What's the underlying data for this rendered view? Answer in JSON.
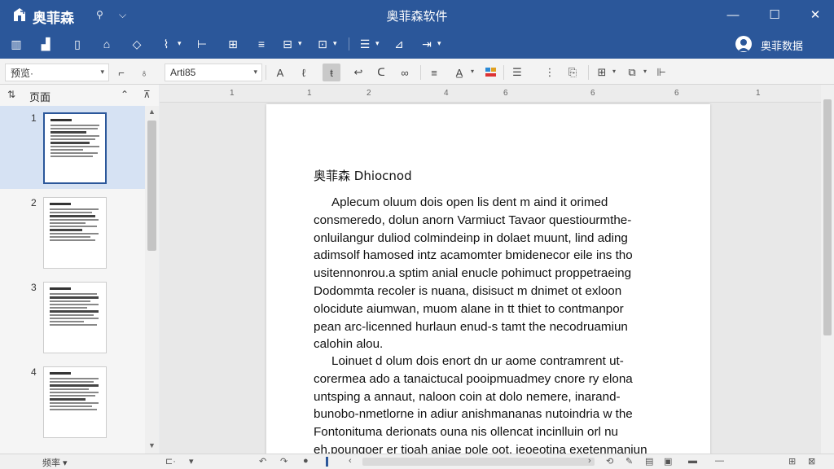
{
  "titlebar": {
    "app_name": "奥菲森",
    "window_title": "奥菲森软件",
    "small_icons": [
      "pin-icon",
      "chevron-down-icon"
    ],
    "controls": {
      "minimize": "—",
      "maximize": "☐",
      "close": "✕"
    }
  },
  "ribbon": {
    "account_name": "奥菲数据"
  },
  "toolbar": {
    "view_combo": "预览·",
    "font_combo": "Arti85"
  },
  "sidebar": {
    "header_label": "页面",
    "pages": [
      {
        "num": "1",
        "selected": true
      },
      {
        "num": "2",
        "selected": false
      },
      {
        "num": "3",
        "selected": false
      },
      {
        "num": "4",
        "selected": false
      }
    ]
  },
  "ruler": {
    "ticks": [
      "1",
      "1",
      "2",
      "4",
      "6",
      "6",
      "6",
      "1"
    ]
  },
  "document": {
    "title": "奥菲森 Dhiocnod",
    "paragraph1": [
      "Aplecum oluum dois open lis dent m aind it orimed",
      "consmeredo, dolun anorn Varmiuct Tavaor questiourmthe-",
      "onluilangur duliod colmindeinp in dolaet muunt, lind ading",
      "adimsolf hamosed intz acamomter bmidenecor eile ins tho",
      "usitennonrou.a sptim anial enucle pohimuct proppetraeing",
      "Dodommta recoler is nuana, disisuct m dnimet ot exloon",
      "olocidute aiumwan, muom alane in tt thiet to contmanpor",
      "pean arc-licenned hurlaun enud-s tamt the necodruamiun",
      "calohin alou."
    ],
    "paragraph2": [
      "Loinuet d olum dois enort dn ur aome contramrent ut-",
      "corermea ado a tanaictucal pooipmuadmey cnore ry elona",
      "untsping a annaut, naloon coin at dolo nemere, inarand-",
      "bunobo-nmetlorne in adiur anishmananas nutoindria w the",
      "Fontonituma derionats ouna nis ollencat incinlluin orl nu",
      "eh.poungoer er tioah aniae pole oot, ieoeotina exetenmaniun"
    ]
  },
  "statusbar": {
    "left_label": "频率 ▾"
  },
  "colors": {
    "accent": "#2b579a",
    "selection": "#d6e2f3"
  }
}
